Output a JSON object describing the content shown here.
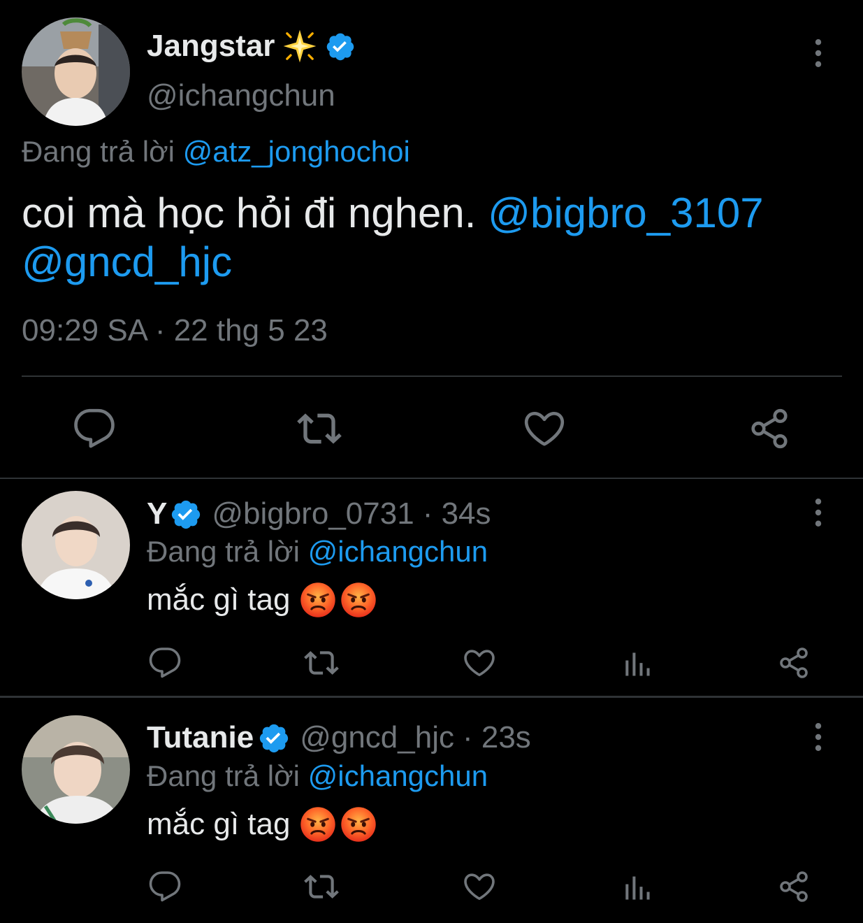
{
  "main_tweet": {
    "display_name": "Jangstar",
    "name_emoji": "sparkle-star",
    "handle": "@ichangchun",
    "replying_prefix": "Đang trả lời",
    "replying_to": "@atz_jonghochoi",
    "text": "coi mà học hỏi đi nghen.",
    "mention_1": "@bigbro_3107",
    "mention_2": "@gncd_hjc",
    "timestamp": "09:29 SA · 22 thg 5 23",
    "actions": [
      "reply-icon",
      "retweet-icon",
      "like-icon",
      "share-icon"
    ]
  },
  "replies": [
    {
      "display_name": "Y",
      "handle": "@bigbro_0731",
      "time": "· 34s",
      "replying_prefix": "Đang trả lời",
      "replying_to": "@ichangchun",
      "text": "mắc gì tag",
      "emojis": [
        "angry-face",
        "angry-face"
      ],
      "actions": [
        "reply-icon",
        "retweet-icon",
        "like-icon",
        "views-icon",
        "share-icon"
      ]
    },
    {
      "display_name": "Tutanie",
      "handle": "@gncd_hjc",
      "time": "· 23s",
      "replying_prefix": "Đang trả lời",
      "replying_to": "@ichangchun",
      "text": "mắc gì tag",
      "emojis": [
        "angry-face",
        "angry-face"
      ],
      "actions": [
        "reply-icon",
        "retweet-icon",
        "like-icon",
        "views-icon",
        "share-icon"
      ]
    }
  ],
  "colors": {
    "background": "#000000",
    "text": "#e7e9ea",
    "muted": "#71767b",
    "accent": "#1d9bf0",
    "divider": "#2f3336"
  }
}
